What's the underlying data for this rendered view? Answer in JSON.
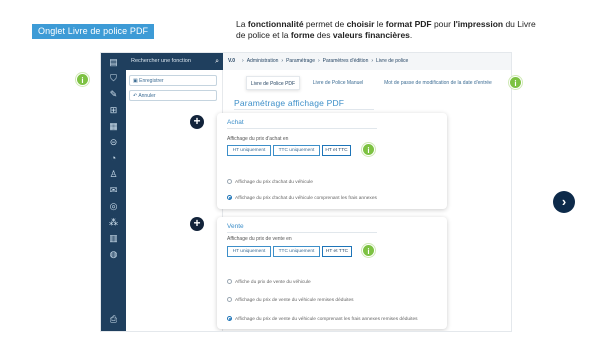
{
  "slide": {
    "badge": "Onglet Livre de police PDF",
    "description": {
      "p1": "La ",
      "b1": "fonctionnalité",
      "p2": " permet de ",
      "b2": "choisir",
      "p3": " le ",
      "b3": "format PDF",
      "p4": " pour ",
      "b4": "l'impression",
      "p5": " du Livre de police et la ",
      "b5": "forme",
      "p6": " des ",
      "b6": "valeurs financières",
      "p7": "."
    },
    "next_glyph": "›",
    "hint_glyph": "i",
    "plus_glyph": "+"
  },
  "app": {
    "search": {
      "placeholder": "Rechercher une fonction"
    },
    "sidebar_icons": [
      "home-icon",
      "cart-icon",
      "wrench-icon",
      "car-icon",
      "document-icon",
      "key-icon",
      "gauge-icon",
      "person-icon",
      "mail-icon",
      "target-icon",
      "group-icon",
      "chart-icon",
      "globe-icon",
      "printer-icon"
    ],
    "left_panel": {
      "save": "Enregistrer",
      "cancel": "Annuler"
    },
    "breadcrumb": {
      "version": "V.0",
      "items": [
        "Administration",
        "Paramétrage",
        "Paramètres d'édition",
        "Livre de police"
      ],
      "separator": "›"
    },
    "tabs": [
      "Livre de Police PDF",
      "Livre de Police Manuel",
      "Mot de passe de modification de la date d'entrée"
    ],
    "section_title": "Paramétrage affichage PDF",
    "achat": {
      "title": "Achat",
      "label": "Affichage du prix d'achat en",
      "options": [
        "HT uniquement",
        "TTC uniquement",
        "HT et TTC"
      ],
      "selected": 2,
      "radios": [
        "Affichage du prix d'achat du véhicule",
        "Affichage du prix d'achat du véhicule comprenant les frais annexes"
      ],
      "radio_selected": 1
    },
    "vente": {
      "title": "Vente",
      "label": "Affichage du prix de vente en",
      "options": [
        "HT uniquement",
        "TTC uniquement",
        "HT et TTC"
      ],
      "selected": 2,
      "radios": [
        "Affiche du prix de vente du véhicule",
        "Affichage du prix de vente du véhicule remises déduites",
        "Affichage du prix de vente du véhicule comprenant les frais annexes remises déduites"
      ],
      "radio_selected": 2
    }
  }
}
